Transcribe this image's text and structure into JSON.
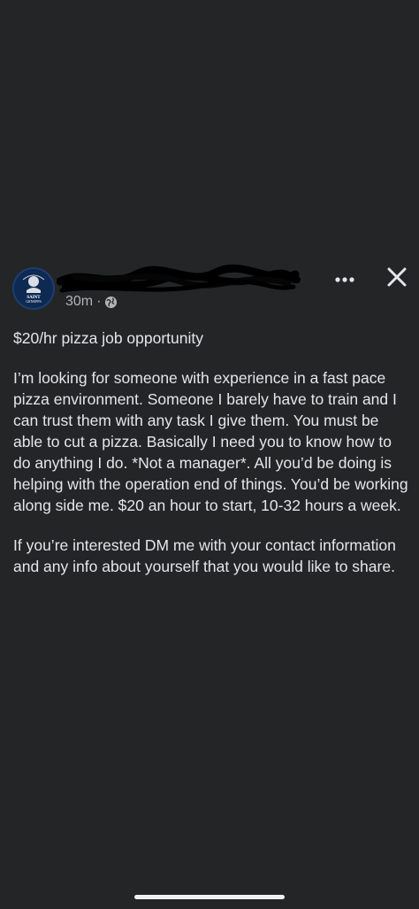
{
  "post": {
    "author_name": "",
    "timestamp": "30m",
    "separator": "·",
    "privacy_icon": "globe-icon",
    "avatar_lines": [
      "SAINT",
      "GENEPPS"
    ],
    "paragraphs": [
      "$20/hr pizza job opportunity",
      "I’m looking for someone with experience in a fast pace pizza environment.  Someone I barely have to train and I can trust them with any task I give them.  You must be able to cut a pizza.  Basically I need you to know how to do anything I do.  *Not a manager*. All you’d be doing is helping with the operation end of things.  You’d be working along side me. $20 an hour to start, 10-32 hours a week.",
      "If you’re interested DM me with your contact information and any info about yourself that you would like to share."
    ]
  },
  "actions": {
    "more_icon": "more-horizontal-icon",
    "close_icon": "close-icon"
  },
  "colors": {
    "background": "#242526",
    "text_primary": "#e4e6eb",
    "text_secondary": "#b0b3b8",
    "avatar_bg": "#0e2a52"
  }
}
